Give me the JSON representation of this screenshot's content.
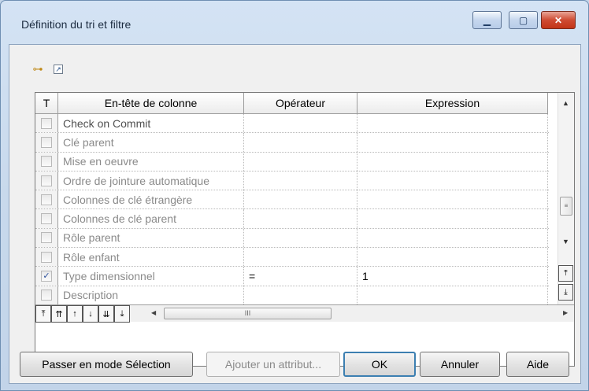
{
  "window": {
    "title": "Définition du tri et filtre",
    "controls": {
      "minimize": "▁",
      "maximize": "▢",
      "close": "✕"
    }
  },
  "toolbar": {
    "icons": [
      "sort-tree-icon",
      "link-icon"
    ]
  },
  "grid": {
    "columns": [
      "T",
      "En-tête de colonne",
      "Opérateur",
      "Expression"
    ],
    "rows": [
      {
        "checked": false,
        "name": "Check on Commit",
        "operator": "",
        "expression": ""
      },
      {
        "checked": false,
        "name": "Clé parent",
        "operator": "",
        "expression": ""
      },
      {
        "checked": false,
        "name": "Mise en oeuvre",
        "operator": "",
        "expression": ""
      },
      {
        "checked": false,
        "name": "Ordre de jointure automatique",
        "operator": "",
        "expression": ""
      },
      {
        "checked": false,
        "name": "Colonnes de clé étrangère",
        "operator": "",
        "expression": ""
      },
      {
        "checked": false,
        "name": "Colonnes de clé parent",
        "operator": "",
        "expression": ""
      },
      {
        "checked": false,
        "name": "Rôle parent",
        "operator": "",
        "expression": ""
      },
      {
        "checked": false,
        "name": "Rôle enfant",
        "operator": "",
        "expression": ""
      },
      {
        "checked": true,
        "name": "Type dimensionnel",
        "operator": "=",
        "expression": "1"
      },
      {
        "checked": false,
        "name": "Description",
        "operator": "",
        "expression": ""
      }
    ],
    "check_mark": "✓",
    "hscroll_grip": "III",
    "vscroll_grip": "≡",
    "nav_buttons": [
      "⤒",
      "⇈",
      "↑",
      "↓",
      "⇊",
      "⤓"
    ],
    "vnav_buttons": [
      "⤒",
      "⤓"
    ]
  },
  "buttons": {
    "selection_mode": "Passer en mode Sélection",
    "add_attribute": "Ajouter un attribut...",
    "ok": "OK",
    "cancel": "Annuler",
    "help": "Aide"
  }
}
